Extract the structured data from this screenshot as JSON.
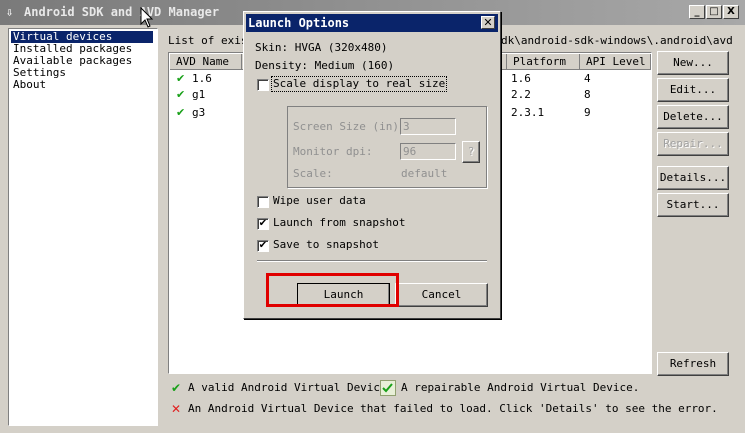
{
  "window": {
    "title": "Android SDK and AVD Manager",
    "icon": "download-arrow-icon",
    "controls": [
      "_",
      "□",
      "X"
    ]
  },
  "sidebar": {
    "items": [
      {
        "label": "Virtual devices",
        "selected": true
      },
      {
        "label": "Installed packages",
        "selected": false
      },
      {
        "label": "Available packages",
        "selected": false
      },
      {
        "label": "Settings",
        "selected": false
      },
      {
        "label": "About",
        "selected": false
      }
    ]
  },
  "main": {
    "path_label_left": "List of exis",
    "path_label_right": "dk\\android-sdk-windows\\.android\\avd",
    "table": {
      "headers": {
        "name": "AVD Name",
        "platform": "Platform",
        "api": "API Level"
      },
      "rows": [
        {
          "status": "valid",
          "name": "1.6",
          "platform": "1.6",
          "api": "4"
        },
        {
          "status": "valid",
          "name": "g1",
          "platform": "2.2",
          "api": "8"
        },
        {
          "status": "valid",
          "name": "g3",
          "platform": "2.3.1",
          "api": "9"
        }
      ]
    },
    "buttons": {
      "new": "New...",
      "edit": "Edit...",
      "delete": "Delete...",
      "repair": "Repair...",
      "details": "Details...",
      "start": "Start...",
      "refresh": "Refresh"
    },
    "legend": {
      "valid": "A valid Android Virtual Device.",
      "repairable": "A repairable Android Virtual Device.",
      "failed": "An Android Virtual Device that failed to load. Click 'Details' to see the error."
    }
  },
  "dialog": {
    "title": "Launch Options",
    "skin": "Skin:   HVGA (320x480)",
    "density": "Density: Medium (160)",
    "scale_display": {
      "label": "Scale display to real size",
      "checked": false
    },
    "screen_size": {
      "label": "Screen Size (in):",
      "value": "3"
    },
    "monitor_dpi": {
      "label": "Monitor dpi:",
      "value": "96",
      "help": "?"
    },
    "scale": {
      "label": "Scale:",
      "value": "default"
    },
    "wipe_user_data": {
      "label": "Wipe user data",
      "checked": false
    },
    "launch_from_snapshot": {
      "label": "Launch from snapshot",
      "checked": true
    },
    "save_to_snapshot": {
      "label": "Save to snapshot",
      "checked": true
    },
    "launch_button": "Launch",
    "cancel_button": "Cancel"
  },
  "colors": {
    "highlight": "#0a246a",
    "annotation_box": "#e00000",
    "valid_check": "#18a018",
    "error_x": "#e02020"
  }
}
